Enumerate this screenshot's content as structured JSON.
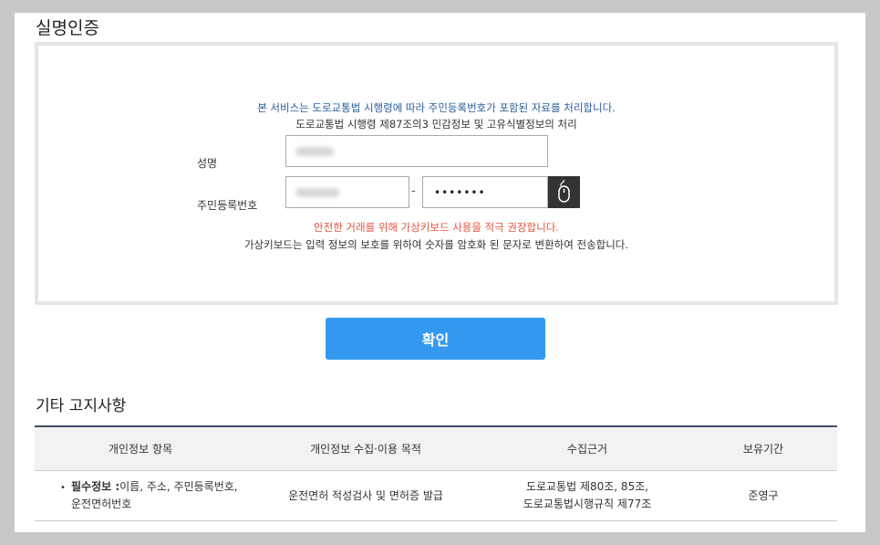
{
  "section_title": "실명인증",
  "notice": {
    "line1": "본 서비스는 도로교통법 시행령에 따라 주민등록번호가 포함된 자료를 처리합니다.",
    "line2": "도로교통법 시행령 제87조의3 민감정보 및 고유식별정보의 처리"
  },
  "form": {
    "name_label": "성명",
    "rrn_label": "주민등록번호",
    "rrn_separator": "-",
    "rrn_back_masked": "•••••••",
    "keypad_icon": "mouse-icon"
  },
  "warning": "안전한 거래를 위해 가상키보드 사용을 적극 권장합니다.",
  "keypad_info": "가상키보드는 입력 정보의 보호를 위하여 숫자를 암호화 된 문자로 변환하여 전송합니다.",
  "confirm_label": "확인",
  "other_notice_title": "기타 고지사항",
  "table": {
    "headers": [
      "개인정보 항목",
      "개인정보 수집·이용 목적",
      "수집근거",
      "보유기간"
    ],
    "rows": [
      {
        "bullet": "•",
        "required_label": "필수정보 :",
        "items_line1": "이름, 주소, 주민등록번호,",
        "items_line2": "운전면허번호",
        "purpose": "운전면허 적성검사 및 면허증 발급",
        "basis_line1": "도로교통법 제80조, 85조,",
        "basis_line2": "도로교통법시행규칙 제77조",
        "retention": "준영구"
      }
    ]
  },
  "colors": {
    "accent": "#3399ee",
    "notice_blue": "#2b5c99",
    "warning_red": "#e0563d",
    "table_top_border": "#3d4e66"
  }
}
